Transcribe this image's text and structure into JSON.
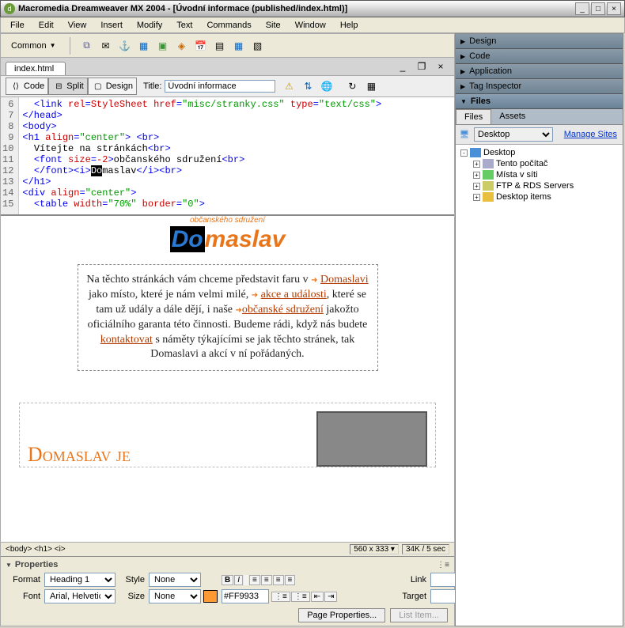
{
  "titlebar": "Macromedia Dreamweaver MX 2004 - [Úvodní informace (published/index.html)]",
  "menus": [
    "File",
    "Edit",
    "View",
    "Insert",
    "Modify",
    "Text",
    "Commands",
    "Site",
    "Window",
    "Help"
  ],
  "insertbar": {
    "category": "Common"
  },
  "doc": {
    "tab": "index.html",
    "title_label": "Title:",
    "title_value": "Úvodní informace"
  },
  "viewbtns": {
    "code": "Code",
    "split": "Split",
    "design": "Design"
  },
  "code": {
    "lines": [
      {
        "n": 6,
        "pre": "  ",
        "html": "<span class='c-tag'>&lt;link</span> <span class='c-attr'>rel</span><span class='c-tag'>=</span><span class='c-attr'>StyleSheet</span> <span class='c-attr'>href</span><span class='c-tag'>=</span><span class='c-str'>\"misc/stranky.css\"</span> <span class='c-attr'>type</span><span class='c-tag'>=</span><span class='c-str'>\"text/css\"</span><span class='c-tag'>&gt;</span>"
      },
      {
        "n": 7,
        "pre": "",
        "html": "<span class='c-tag'>&lt;/head&gt;</span>"
      },
      {
        "n": 8,
        "pre": "",
        "html": "<span class='c-tag'>&lt;body&gt;</span>"
      },
      {
        "n": 9,
        "pre": "",
        "html": "<span class='c-tag'>&lt;h1 </span><span class='c-attr'>align</span><span class='c-tag'>=</span><span class='c-str'>\"center\"</span><span class='c-tag'>&gt; &lt;br&gt;</span>"
      },
      {
        "n": 10,
        "pre": "  ",
        "html": "<span class='c-txt'>Vítejte na stránkách</span><span class='c-tag'>&lt;br&gt;</span>"
      },
      {
        "n": 11,
        "pre": "  ",
        "html": "<span class='c-tag'>&lt;font </span><span class='c-attr'>size</span><span class='c-tag'>=</span><span class='c-attr'>-2</span><span class='c-tag'>&gt;</span><span class='c-txt'>občanského sdružení</span><span class='c-tag'>&lt;br&gt;</span>"
      },
      {
        "n": 12,
        "pre": "  ",
        "html": "<span class='c-tag'>&lt;/font&gt;&lt;i&gt;</span><span class='c-sel'>Do</span><span class='c-txt'>maslav</span><span class='c-tag'>&lt;/i&gt;&lt;br&gt;</span>"
      },
      {
        "n": 13,
        "pre": "",
        "html": "<span class='c-tag'>&lt;/h1&gt;</span>"
      },
      {
        "n": 14,
        "pre": "",
        "html": "<span class='c-tag'>&lt;div </span><span class='c-attr'>align</span><span class='c-tag'>=</span><span class='c-str'>\"center\"</span><span class='c-tag'>&gt;</span>"
      },
      {
        "n": 15,
        "pre": "  ",
        "html": "<span class='c-tag'>&lt;table </span><span class='c-attr'>width</span><span class='c-tag'>=</span><span class='c-str'>\"70%\"</span> <span class='c-attr'>border</span><span class='c-tag'>=</span><span class='c-str'>\"0\"</span><span class='c-tag'>&gt;</span>"
      }
    ]
  },
  "design": {
    "subtitle": "občanského sdružení",
    "logo": {
      "do": "Do",
      "rest": "maslav"
    },
    "intro": {
      "t1": "Na těchto stránkách vám chceme představit faru v ",
      "l1": "Domaslavi",
      "t2": " jako místo, které je nám velmi milé, ",
      "l2": "akce a události",
      "t3": ", které se tam už udály a dále dějí, i naše ",
      "l3": "občanské sdružení",
      "t4": " jakožto oficiálního garanta této činnosti.  Budeme rádi, když nás budete ",
      "l4": "kontaktovat",
      "t5": " s náměty týkajícími se jak těchto stránek, tak Domaslavi a akcí v ní pořádaných."
    },
    "faint": "Domaslav je"
  },
  "status": {
    "tagpath": "<body> <h1> <i>",
    "dims": "560 x 333",
    "size": "34K / 5 sec"
  },
  "props": {
    "title": "Properties",
    "format": {
      "lbl": "Format",
      "val": "Heading 1"
    },
    "style": {
      "lbl": "Style",
      "val": "None"
    },
    "link": {
      "lbl": "Link",
      "val": ""
    },
    "font": {
      "lbl": "Font",
      "val": "Arial, Helvetica"
    },
    "size": {
      "lbl": "Size",
      "val": "None"
    },
    "color": {
      "swatch": "#FF9933",
      "val": "#FF9933"
    },
    "target": {
      "lbl": "Target",
      "val": ""
    },
    "pageprops": "Page Properties...",
    "listitem": "List Item..."
  },
  "right": {
    "panels": [
      "Design",
      "Code",
      "Application",
      "Tag Inspector",
      "Files"
    ],
    "tabs": {
      "files": "Files",
      "assets": "Assets"
    },
    "dropdown": "Desktop",
    "manage": "Manage Sites",
    "tree": [
      {
        "indent": 0,
        "icon": "ico-desktop",
        "label": "Desktop",
        "exp": "-"
      },
      {
        "indent": 1,
        "icon": "ico-mycomp",
        "label": "Tento počítač",
        "exp": "+"
      },
      {
        "indent": 1,
        "icon": "ico-net",
        "label": "Místa v síti",
        "exp": "+"
      },
      {
        "indent": 1,
        "icon": "ico-ftp",
        "label": "FTP & RDS Servers",
        "exp": "+"
      },
      {
        "indent": 1,
        "icon": "ico-folder",
        "label": "Desktop items",
        "exp": "+"
      }
    ]
  }
}
